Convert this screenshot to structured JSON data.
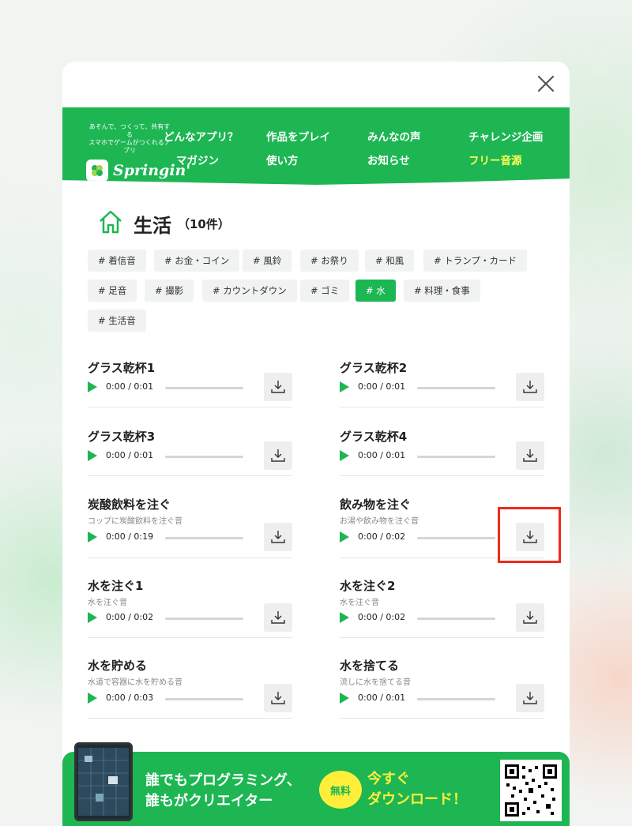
{
  "logo": {
    "tagline_1": "あそんで、つくって、共有する",
    "tagline_2": "スマホでゲームがつくれるアプリ",
    "brand": "Springin'"
  },
  "nav": {
    "items": [
      "どんなアプリ？",
      "作品をプレイ",
      "みんなの声",
      "チャレンジ企画",
      "マガジン",
      "使い方",
      "お知らせ",
      "フリー音源"
    ]
  },
  "category": {
    "title": "生活",
    "count": "（10件）"
  },
  "tags": [
    "# 着信音",
    "# お金・コイン",
    "# 風鈴",
    "# お祭り",
    "# 和風",
    "# トランプ・カード",
    "# 足音",
    "# 撮影",
    "# カウントダウン",
    "# ゴミ",
    "# 水",
    "# 料理・食事",
    "# 生活音"
  ],
  "active_tag": "# 水",
  "sounds": [
    {
      "title": "グラス乾杯1",
      "desc": "",
      "time": "0:00",
      "duration": "/ 0:01"
    },
    {
      "title": "グラス乾杯2",
      "desc": "",
      "time": "0:00",
      "duration": "/ 0:01"
    },
    {
      "title": "グラス乾杯3",
      "desc": "",
      "time": "0:00",
      "duration": "/ 0:01"
    },
    {
      "title": "グラス乾杯4",
      "desc": "",
      "time": "0:00",
      "duration": "/ 0:01"
    },
    {
      "title": "炭酸飲料を注ぐ",
      "desc": "コップに炭酸飲料を注ぐ音",
      "time": "0:00",
      "duration": "/ 0:19"
    },
    {
      "title": "飲み物を注ぐ",
      "desc": "お湯や飲み物を注ぐ音",
      "time": "0:00",
      "duration": "/ 0:02"
    },
    {
      "title": "水を注ぐ1",
      "desc": "水を注ぐ音",
      "time": "0:00",
      "duration": "/ 0:02"
    },
    {
      "title": "水を注ぐ2",
      "desc": "水を注ぐ音",
      "time": "0:00",
      "duration": "/ 0:02"
    },
    {
      "title": "水を貯める",
      "desc": "水道で容器に水を貯める音",
      "time": "0:00",
      "duration": "/ 0:03"
    },
    {
      "title": "水を捨てる",
      "desc": "流しに水を捨てる音",
      "time": "0:00",
      "duration": "/ 0:01"
    }
  ],
  "banner": {
    "line1": "誰でもプログラミング、",
    "line2": "誰もがクリエイター",
    "free_badge": "無料",
    "cta1": "今すぐ",
    "cta2": "ダウンロード！"
  },
  "colors": {
    "brand_green": "#1db653",
    "highlight_yellow": "#ffef3a",
    "annotation_red": "#ee2b1b"
  }
}
